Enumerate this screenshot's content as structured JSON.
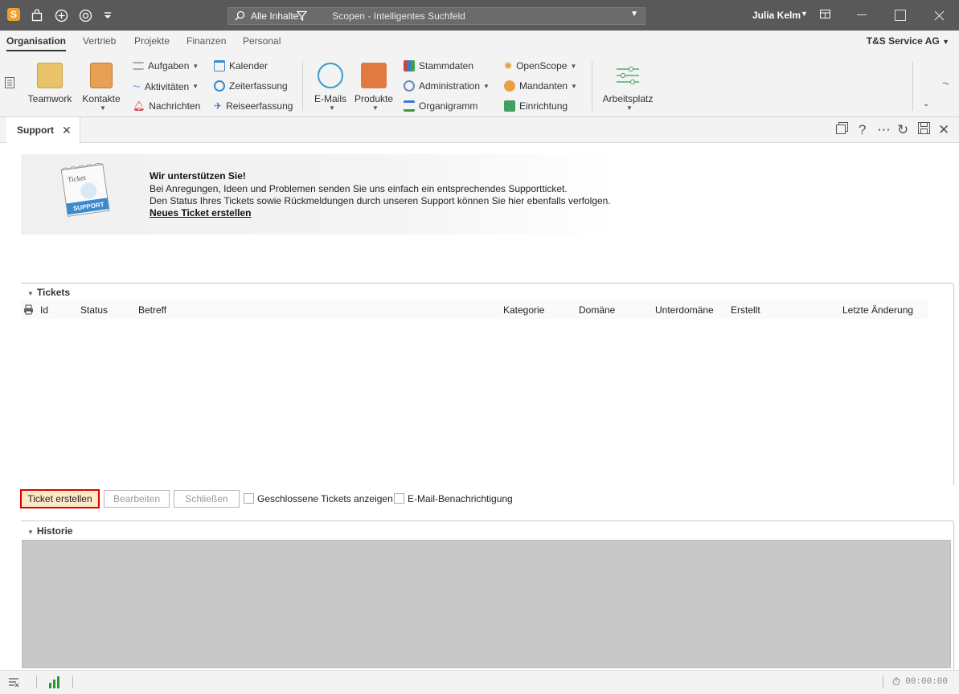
{
  "titlebar": {
    "search_scope": "Alle Inhalte",
    "search_placeholder": "Scopen - Intelligentes Suchfeld",
    "user_name": "Julia Kelm"
  },
  "menu_tabs": [
    "Organisation",
    "Vertrieb",
    "Projekte",
    "Finanzen",
    "Personal"
  ],
  "company": "T&S Service AG",
  "ribbon": {
    "teamwork": "Teamwork",
    "kontakte": "Kontakte",
    "aufgaben": "Aufgaben",
    "aktivitaeten": "Aktivitäten",
    "nachrichten": "Nachrichten",
    "kalender": "Kalender",
    "zeiterfassung": "Zeiterfassung",
    "reiseerfassung": "Reiseerfassung",
    "emails": "E-Mails",
    "produkte": "Produkte",
    "stammdaten": "Stammdaten",
    "administration": "Administration",
    "organigramm": "Organigramm",
    "openscope": "OpenScope",
    "mandanten": "Mandanten",
    "einrichtung": "Einrichtung",
    "arbeitsplatz": "Arbeitsplatz"
  },
  "doc_tab": "Support",
  "banner": {
    "title": "Wir unterstützen Sie!",
    "line1": "Bei Anregungen, Ideen und Problemen senden Sie uns einfach ein entsprechendes Supportticket.",
    "line2": "Den Status Ihres Tickets sowie Rückmeldungen durch unseren Support können Sie hier ebenfalls verfolgen.",
    "link": "Neues Ticket erstellen",
    "image_text_top": "Ticket",
    "image_text_bottom": "SUPPORT"
  },
  "tickets": {
    "header": "Tickets",
    "columns": [
      "Id",
      "Status",
      "Betreff",
      "Kategorie",
      "Domäne",
      "Unterdomäne",
      "Erstellt",
      "Letzte Änderung"
    ]
  },
  "actions": {
    "create": "Ticket erstellen",
    "edit": "Bearbeiten",
    "close": "Schließen",
    "show_closed": "Geschlossene Tickets anzeigen",
    "email_notify": "E-Mail-Benachrichtigung"
  },
  "historie": {
    "header": "Historie"
  },
  "statusbar": {
    "timer": "00:00:00"
  },
  "colors": {
    "titlebar": "#595959",
    "highlight": "#e00000",
    "accent_orange": "#f0a030"
  }
}
